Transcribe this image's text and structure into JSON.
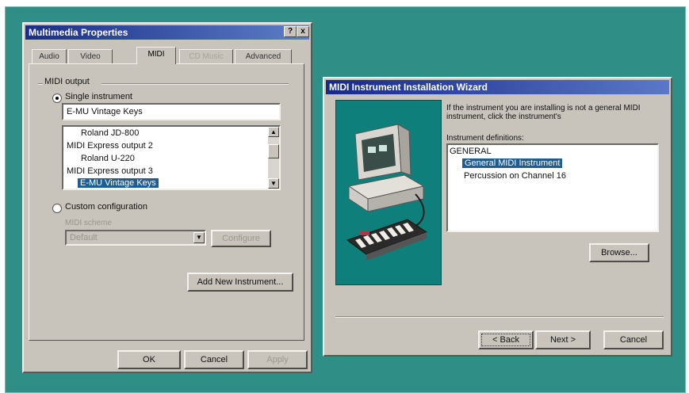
{
  "multimedia": {
    "title": "Multimedia Properties",
    "title_buttons": {
      "help": "?",
      "close": "x"
    },
    "tabs": [
      {
        "label": "Audio",
        "state": "normal"
      },
      {
        "label": "Video",
        "state": "normal"
      },
      {
        "label": "MIDI",
        "state": "active"
      },
      {
        "label": "CD Music",
        "state": "disabled"
      },
      {
        "label": "Advanced",
        "state": "normal"
      }
    ],
    "midi_output_label": "MIDI output",
    "single_instrument_label": "Single instrument",
    "single_instrument_value": "E-MU Vintage Keys",
    "instrument_list": [
      {
        "label": "Roland JD-800",
        "indent": true,
        "selected": false
      },
      {
        "label": "MIDI Express output 2",
        "indent": false,
        "selected": false
      },
      {
        "label": "Roland U-220",
        "indent": true,
        "selected": false
      },
      {
        "label": "MIDI Express output 3",
        "indent": false,
        "selected": false
      },
      {
        "label": "E-MU Vintage Keys",
        "indent": true,
        "selected": true
      }
    ],
    "custom_config_label": "Custom configuration",
    "midi_scheme_label": "MIDI scheme",
    "scheme_value": "Default",
    "configure_label": "Configure",
    "add_instrument_label": "Add New Instrument...",
    "ok_label": "OK",
    "cancel_label": "Cancel",
    "apply_label": "Apply"
  },
  "wizard": {
    "title": "MIDI Instrument Installation Wizard",
    "description": "If the instrument you are installing is not a general MIDI instrument, click the instrument's",
    "definitions_label": "Instrument definitions:",
    "definitions": [
      {
        "label": "GENERAL",
        "indent": false,
        "selected": false
      },
      {
        "label": "General MIDI Instrument",
        "indent": true,
        "selected": true
      },
      {
        "label": "Percussion on Channel 16",
        "indent": true,
        "selected": false
      }
    ],
    "browse_label": "Browse...",
    "back_label": "< Back",
    "next_label": "Next >",
    "cancel_label": "Cancel"
  },
  "colors": {
    "desktop": "#2f8f87",
    "title_active": "#1a2d86",
    "selection": "#1f5c8f"
  }
}
